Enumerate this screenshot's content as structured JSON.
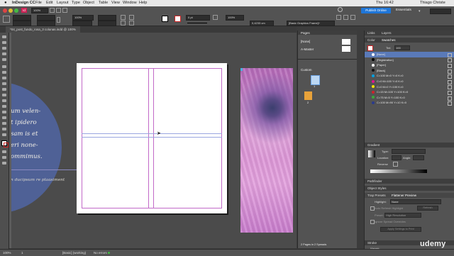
{
  "menubar": {
    "app": "InDesign CC",
    "items": [
      "File",
      "Edit",
      "Layout",
      "Type",
      "Object",
      "Table",
      "View",
      "Window",
      "Help"
    ],
    "user": "Thiago Christe",
    "clock": "Thu 16:42"
  },
  "control": {
    "zoom": "100%",
    "x_val": "0 pt",
    "w_val": "100%",
    "frame_style": "[Basic Graphics Frame]+",
    "width_val": "0,4233 cm",
    "publish_label": "Publish Online",
    "workspace": "Essentials"
  },
  "document": {
    "tab": "*04_post_fundo_rosa_3 colunas.indd @ 100%",
    "zoom_status": "100%",
    "page_status": "1",
    "style_status": "[Basic] (working)",
    "errors_status": "No errors"
  },
  "artwork": {
    "script_lines": [
      "um velen-",
      "t ipidero",
      "sam is et",
      "eri none-",
      "ommimus."
    ],
    "footer_line": "n ducipsum re plaasiment"
  },
  "pages_panel": {
    "title": "Pages",
    "none_label": "[None]",
    "master_label": "A-Master",
    "custom_label": "Custom",
    "page_numbers": [
      "1",
      "2"
    ],
    "status": "2 Pages in 2 Spreads"
  },
  "links_panel": {
    "tabs": [
      "Links",
      "Layers"
    ]
  },
  "swatches_panel": {
    "tabs": [
      "Color",
      "Swatches"
    ],
    "tint_label": "Tint",
    "tint_value": "100",
    "rows": [
      {
        "name": "[None]",
        "color": "#ffffff",
        "selected": true
      },
      {
        "name": "[Registration]",
        "color": "#000000",
        "selected": false
      },
      {
        "name": "[Paper]",
        "color": "#ffffff",
        "selected": false
      },
      {
        "name": "[Black]",
        "color": "#111111",
        "selected": false
      },
      {
        "name": "C=100 M=0 Y=0 K=0",
        "color": "#00a0e0",
        "selected": false
      },
      {
        "name": "C=0 M=100 Y=0 K=0",
        "color": "#e0148c",
        "selected": false
      },
      {
        "name": "C=0 M=0 Y=100 K=0",
        "color": "#f8e400",
        "selected": false
      },
      {
        "name": "C=15 M=100 Y=100 K=0",
        "color": "#d0202a",
        "selected": false
      },
      {
        "name": "C=75 M=5 Y=100 K=0",
        "color": "#3aa83a",
        "selected": false
      },
      {
        "name": "C=100 M=90 Y=10 K=0",
        "color": "#2a3a8c",
        "selected": false
      }
    ]
  },
  "gradient_panel": {
    "title": "Gradient",
    "type_label": "Type:",
    "location_label": "Location:",
    "angle_label": "Angle:",
    "reverse_label": "Reverse"
  },
  "pathfinder_panel": {
    "title": "Pathfinder"
  },
  "object_styles_panel": {
    "title": "Object Styles"
  },
  "preview_panel": {
    "tabs": [
      "Trap Presets",
      "Flattener Preview"
    ],
    "highlight_label": "Highlight:",
    "highlight_value": "None",
    "auto_refresh_label": "Auto Refresh Highlight",
    "refresh_button": "Refresh",
    "preset_label": "Preset:",
    "preset_value": "High Resolution",
    "ignore_label": "Ignore Spread Overrides",
    "apply_button": "Apply Settings to Print"
  },
  "stroke_panel": {
    "title": "Stroke",
    "weight_label": "Weight:"
  },
  "watermark": "udemy"
}
